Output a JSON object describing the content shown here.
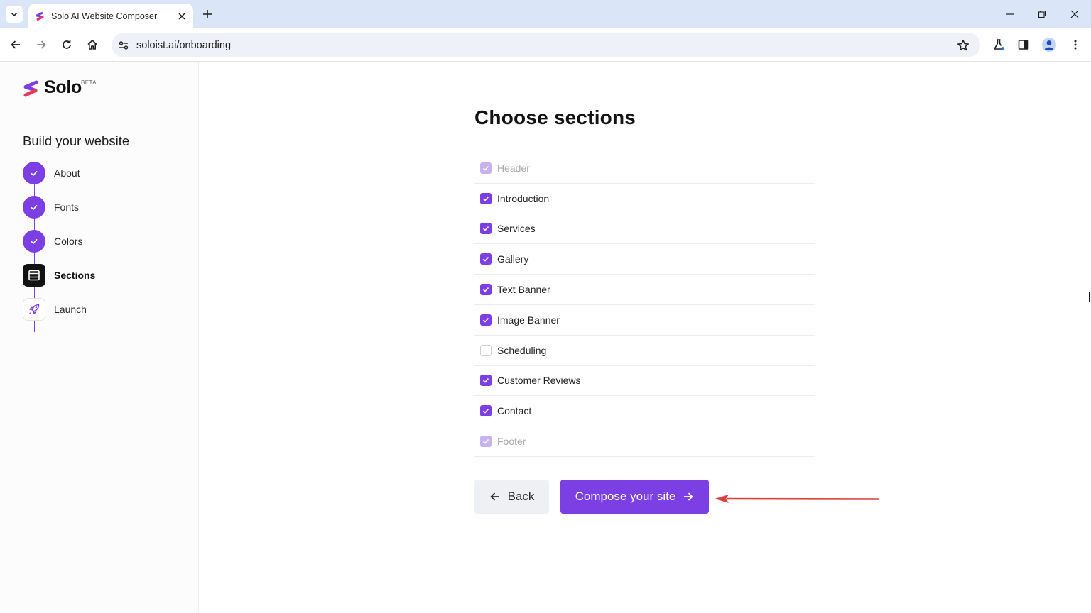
{
  "browser": {
    "tab_title": "Solo AI Website Composer",
    "url": "soloist.ai/onboarding"
  },
  "sidebar": {
    "logo": "Solo",
    "badge": "BETA",
    "heading": "Build your website",
    "steps": [
      {
        "label": "About",
        "status": "complete"
      },
      {
        "label": "Fonts",
        "status": "complete"
      },
      {
        "label": "Colors",
        "status": "complete"
      },
      {
        "label": "Sections",
        "status": "current"
      },
      {
        "label": "Launch",
        "status": "pending"
      }
    ]
  },
  "main": {
    "title": "Choose sections",
    "sections": [
      {
        "label": "Header",
        "checked": true,
        "locked": true
      },
      {
        "label": "Introduction",
        "checked": true,
        "locked": false
      },
      {
        "label": "Services",
        "checked": true,
        "locked": false
      },
      {
        "label": "Gallery",
        "checked": true,
        "locked": false
      },
      {
        "label": "Text Banner",
        "checked": true,
        "locked": false
      },
      {
        "label": "Image Banner",
        "checked": true,
        "locked": false
      },
      {
        "label": "Scheduling",
        "checked": false,
        "locked": false
      },
      {
        "label": "Customer Reviews",
        "checked": true,
        "locked": false
      },
      {
        "label": "Contact",
        "checked": true,
        "locked": false
      },
      {
        "label": "Footer",
        "checked": true,
        "locked": true
      }
    ],
    "back_label": "Back",
    "compose_label": "Compose your site"
  },
  "colors": {
    "accent": "#7b3fe4",
    "accent_locked": "#c6b2ee",
    "annotation_arrow": "#d9423f"
  }
}
